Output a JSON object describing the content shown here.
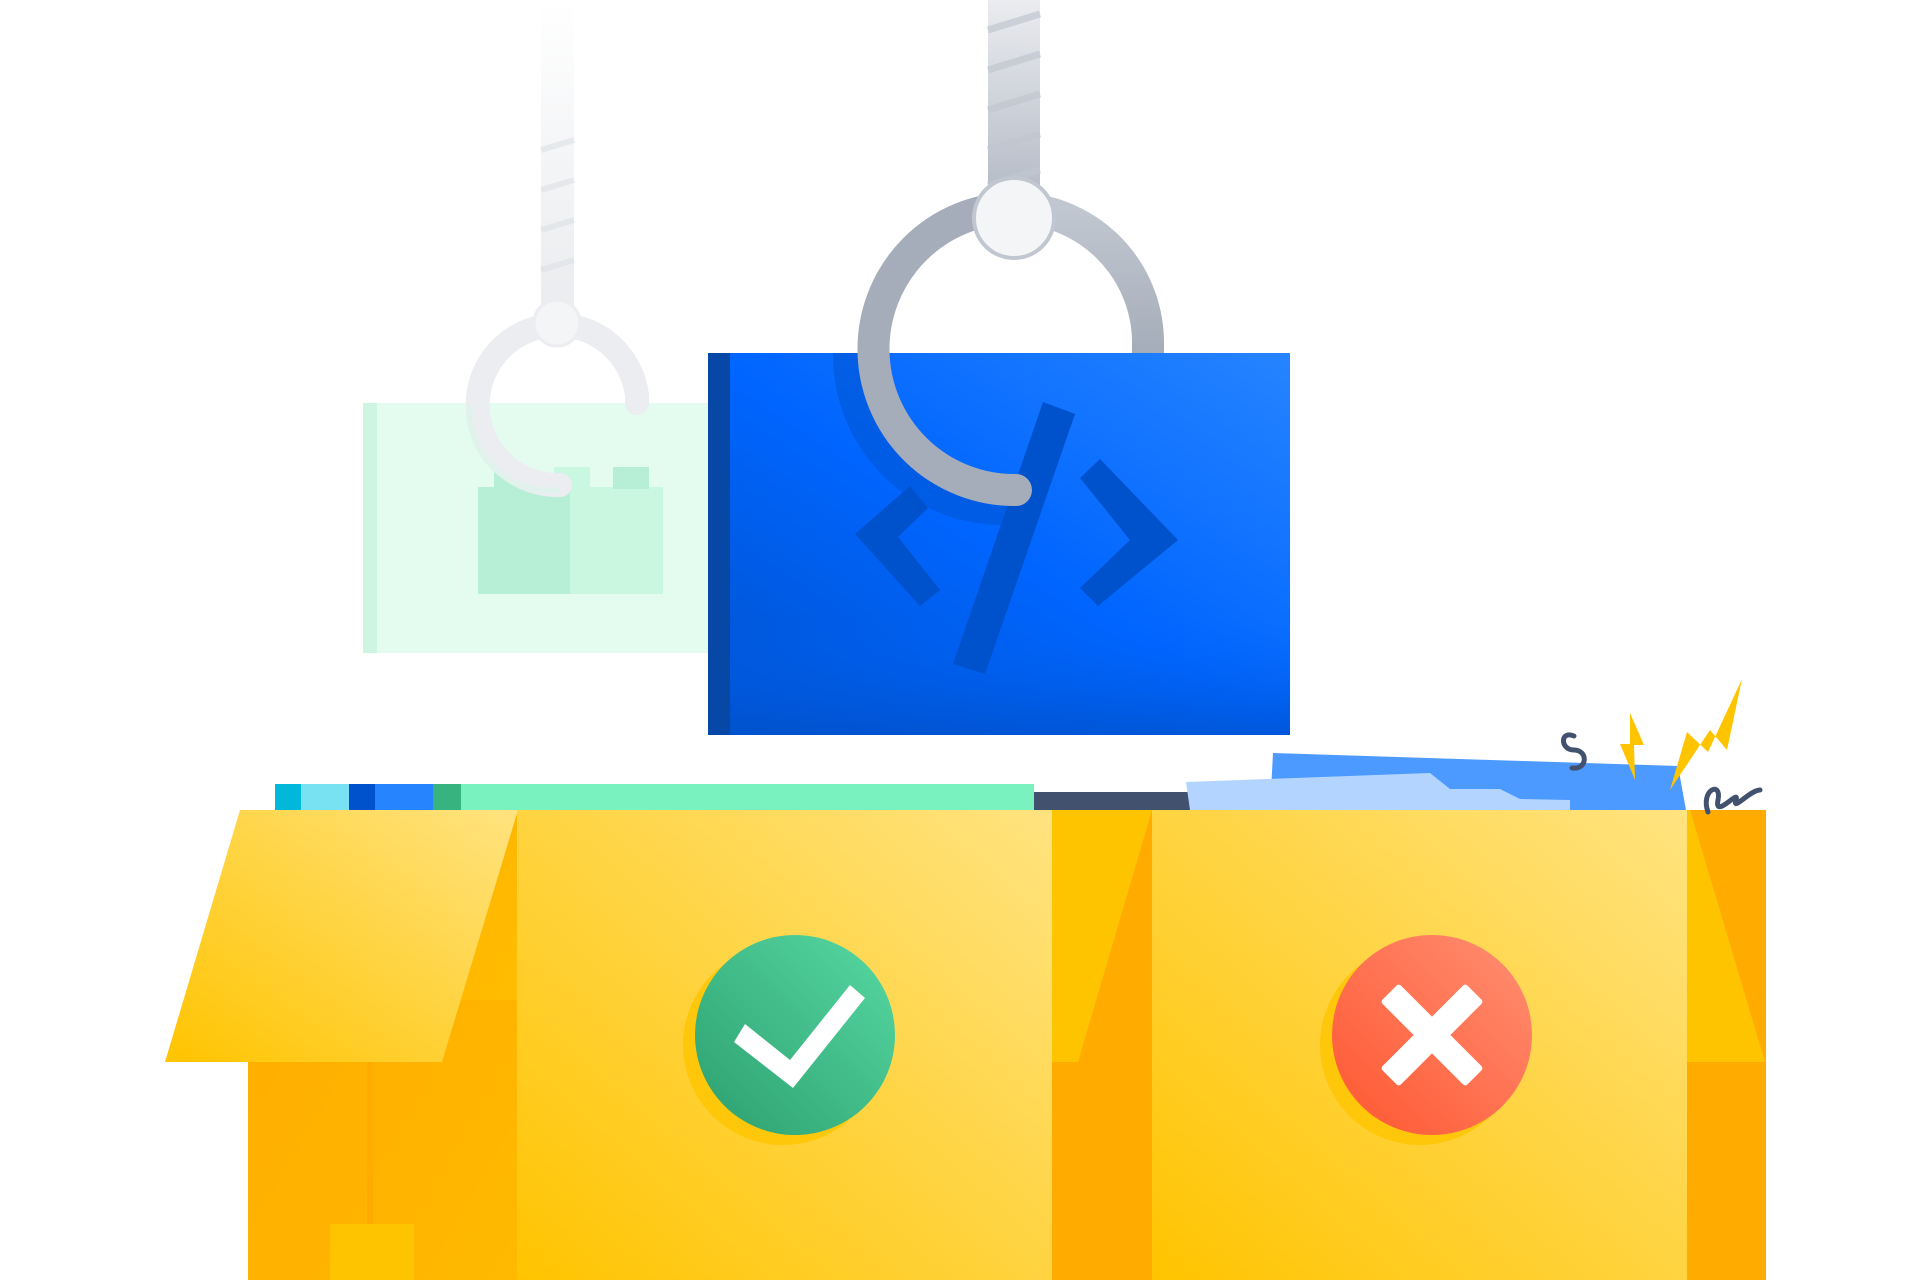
{
  "illustration": {
    "icons": [
      "rope-icon",
      "crane-hook-icon",
      "lego-block-icon",
      "code-brackets-icon",
      "cardboard-box-icon",
      "checkmark-icon",
      "x-mark-icon",
      "lightning-bolt-icon",
      "squiggle-icon"
    ],
    "colors": {
      "background": "#ffffff",
      "code_card": "#0065FF",
      "code_card_dark": "#0747A6",
      "code_glyph": "#0052CC",
      "block_card": "#E3FCEF",
      "block_piece": "#ABF5D1",
      "rope": "#DFE1E6",
      "hook": "#A5ADBA",
      "box_yellow": "#FFC400",
      "box_dark": "#FFAB00",
      "accept_green": "#36B37E",
      "reject_red": "#FF5630",
      "spark_yellow": "#FFC400",
      "squiggle": "#42526E"
    }
  }
}
